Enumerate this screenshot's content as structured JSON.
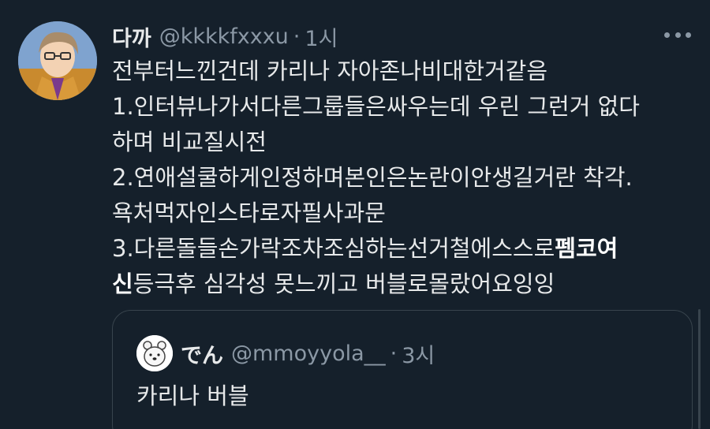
{
  "tweet": {
    "display_name": "다까",
    "handle": "@kkkkfxxxu",
    "separator": "·",
    "time": "1시",
    "lines": [
      "전부터느낀건데 카리나 자아존나비대한거같음",
      "1.인터뷰나가서다른그룹들은싸우는데 우린 그런거 없다",
      "하며 비교질시전",
      "2.연애설쿨하게인정하며본인은논란이안생길거란 착각.",
      "욕처먹자인스타로자필사과문",
      "3.다른돌들손가락조차조심하는선거철에스스로",
      "펨코여",
      "신",
      "등극후 심각성 못느끼고 버블로몰랐어요잉잉"
    ]
  },
  "quote": {
    "display_name": "でん",
    "handle": "@mmoyyola__",
    "separator": "·",
    "time": "3시",
    "text": "카리나 버블"
  },
  "icons": {
    "more": "more-options-icon"
  },
  "colors": {
    "background": "#15202b",
    "text": "#e7e9ea",
    "secondary": "#8b98a5",
    "border": "#38444d"
  }
}
